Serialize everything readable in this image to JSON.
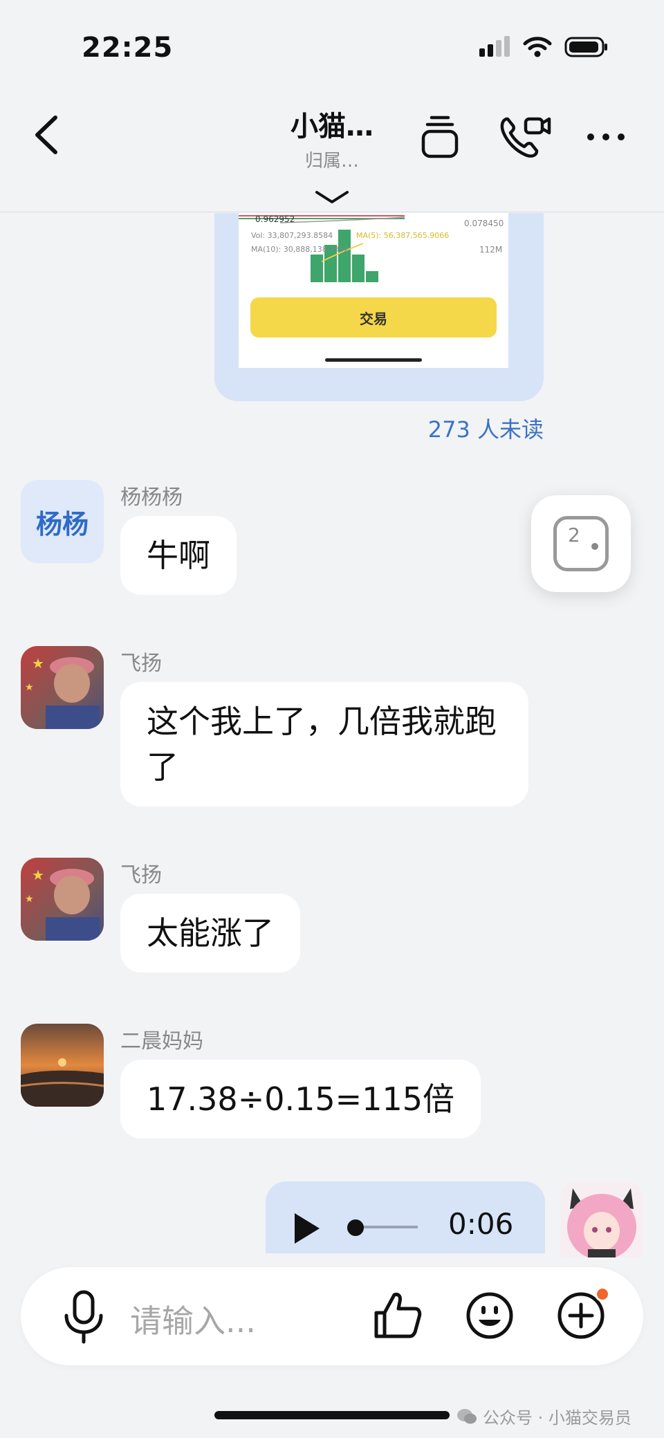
{
  "status_bar": {
    "time": "22:25"
  },
  "header": {
    "title": "小猫…",
    "subtitle": "归属…"
  },
  "shared_image": {
    "price_label": "0.962952",
    "vol_line": "Vol: 33,807,293.8584",
    "ma5_line": "MA(5): 56,387,565.9066",
    "ma10_line": "MA(10): 30,888,138.7352",
    "right_value_1": "0.078450",
    "right_value_2": "112M",
    "trade_button": "交易"
  },
  "unread_count": "273 人未读",
  "float_button_count": "2",
  "messages": [
    {
      "sender": "杨杨杨",
      "avatar_text": "杨杨",
      "text": "牛啊"
    },
    {
      "sender": "飞扬",
      "text": "这个我上了，几倍我就跑了"
    },
    {
      "sender": "飞扬",
      "text": "太能涨了"
    },
    {
      "sender": "二晨妈妈",
      "text": "17.38÷0.15=115倍"
    }
  ],
  "voice_message": {
    "duration": "0:06"
  },
  "input": {
    "placeholder": "请输入..."
  },
  "watermark": "公众号 · 小猫交易员",
  "colors": {
    "accent": "#3a72c7",
    "bubble_self": "#d7e3f7",
    "trade_button": "#f5d84a",
    "notif_dot": "#f0652a"
  }
}
